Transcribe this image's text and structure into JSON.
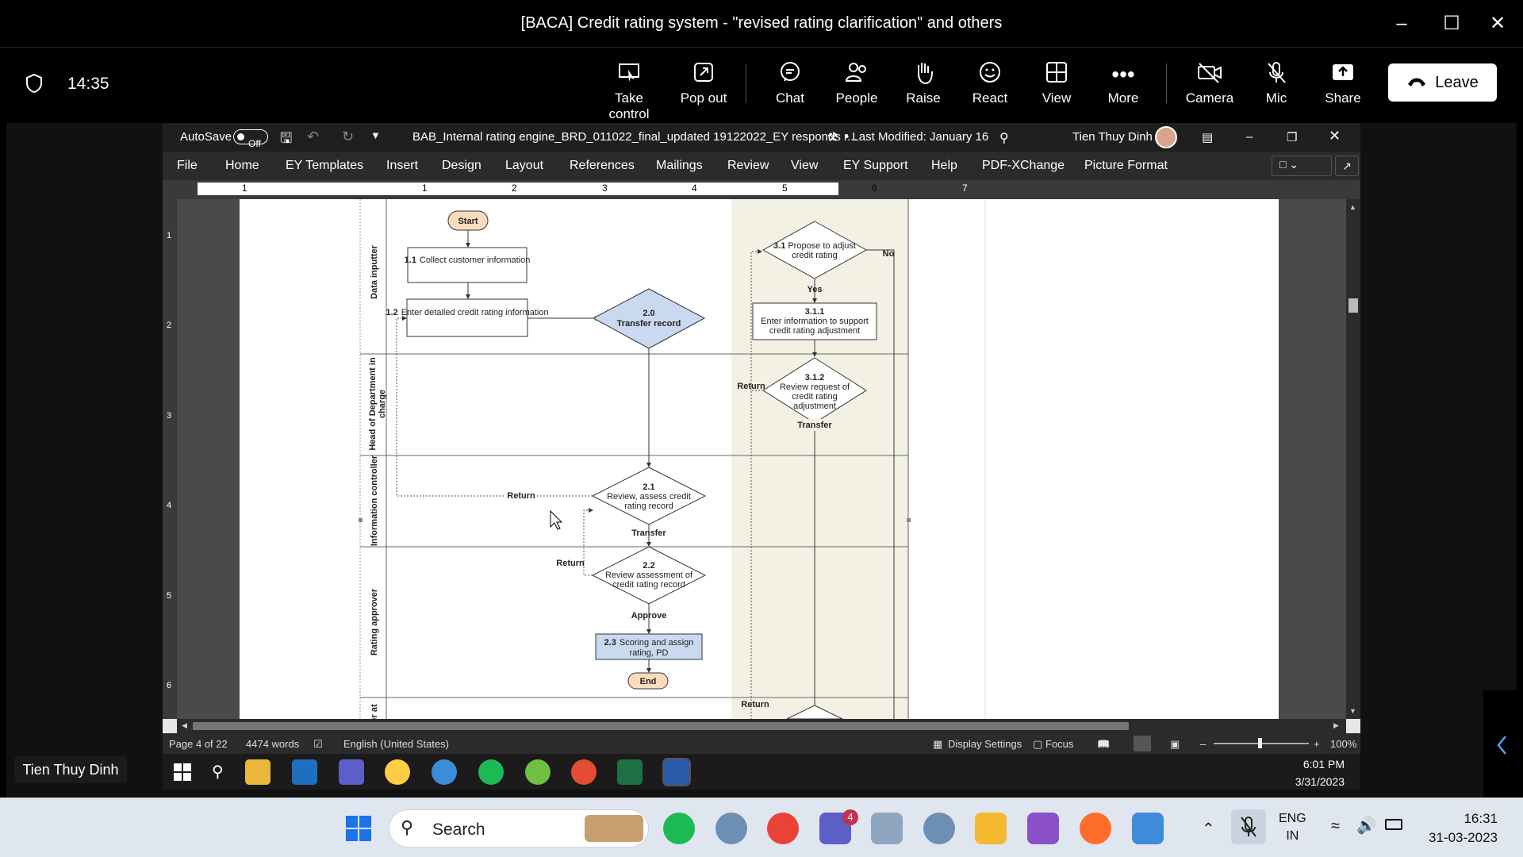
{
  "teams": {
    "window_title": "[BACA] Credit rating system - \"revised rating clarification\" and others",
    "timer": "14:35",
    "buttons": {
      "take_control": "Take control",
      "pop_out": "Pop out",
      "chat": "Chat",
      "people": "People",
      "raise": "Raise",
      "react": "React",
      "view": "View",
      "more": "More",
      "camera": "Camera",
      "mic": "Mic",
      "share": "Share",
      "leave": "Leave"
    },
    "presenter_name": "Tien Thuy Dinh"
  },
  "word": {
    "autosave_label": "AutoSave",
    "autosave_state": "Off",
    "doc_title": "BAB_Internal rating engine_BRD_011022_final_updated 19122022_EY responds r...",
    "last_modified": "• Last Modified: January 16",
    "user_name": "Tien Thuy Dinh",
    "menu": [
      "File",
      "Home",
      "EY Templates",
      "Insert",
      "Design",
      "Layout",
      "References",
      "Mailings",
      "Review",
      "View",
      "EY Support",
      "Help",
      "PDF-XChange",
      "Picture Format"
    ],
    "ruler_marks": [
      "1",
      "1",
      "2",
      "3",
      "4",
      "5",
      "6",
      "7"
    ],
    "vruler_marks": [
      "1",
      "2",
      "3",
      "4",
      "5",
      "6"
    ],
    "status": {
      "page": "Page 4 of 22",
      "words": "4474 words",
      "language": "English (United States)",
      "display_settings": "Display Settings",
      "focus": "Focus",
      "zoom": "100%"
    },
    "remote_clock": {
      "time": "6:01 PM",
      "date": "3/31/2023"
    }
  },
  "flowchart": {
    "lanes": [
      "Data inputter",
      "Head of Department in charge",
      "Information controller",
      "Rating approver",
      "er at"
    ],
    "start": "Start",
    "end": "End",
    "n11_num": "1.1",
    "n11_text": "Collect customer information",
    "n12_num": "1.2",
    "n12_text": "Enter detailed credit rating information",
    "n20_num": "2.0",
    "n20_text": "Transfer record",
    "n21_num": "2.1",
    "n21_text_a": "Review, assess credit",
    "n21_text_b": "rating record",
    "n22_num": "2.2",
    "n22_text_a": "Review assessment of",
    "n22_text_b": "credit rating record",
    "n23_num": "2.3",
    "n23_text_a": "Scoring and assign",
    "n23_text_b": "rating, PD",
    "n31_num": "3.1",
    "n31_text_a": "Propose to adjust",
    "n31_text_b": "credit rating",
    "n311_num": "3.1.1",
    "n311_text_a": "Enter information to support",
    "n311_text_b": "credit rating adjustment",
    "n312_num": "3.1.2",
    "n312_text_a": "Review request of",
    "n312_text_b": "credit rating",
    "n312_text_c": "adjustment",
    "labels": {
      "no": "No",
      "yes": "Yes",
      "return": "Return",
      "transfer": "Transfer",
      "approve": "Approve"
    }
  },
  "taskbar": {
    "search_placeholder": "Search",
    "teams_badge": "4",
    "lang_a": "ENG",
    "lang_b": "IN",
    "time": "16:31",
    "date": "31-03-2023"
  }
}
